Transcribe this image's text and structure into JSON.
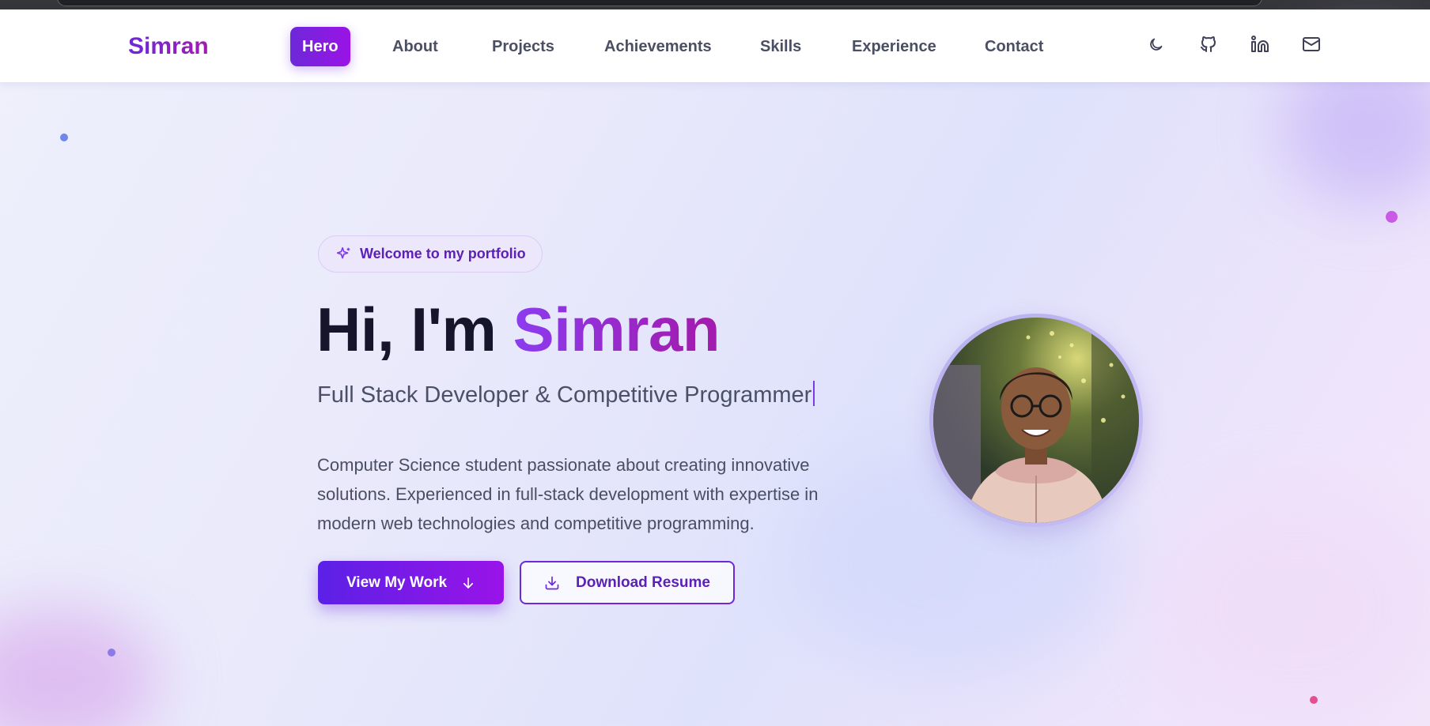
{
  "brand": {
    "name": "Simran"
  },
  "nav": {
    "items": [
      {
        "label": "Hero",
        "active": true
      },
      {
        "label": "About",
        "active": false
      },
      {
        "label": "Projects",
        "active": false
      },
      {
        "label": "Achievements",
        "active": false
      },
      {
        "label": "Skills",
        "active": false
      },
      {
        "label": "Experience",
        "active": false
      },
      {
        "label": "Contact",
        "active": false
      }
    ],
    "icons": [
      "moon-icon",
      "github-icon",
      "linkedin-icon",
      "mail-icon"
    ]
  },
  "hero": {
    "badge": "Welcome to my portfolio",
    "greeting": "Hi, I'm",
    "name": "Simran",
    "subtitle": "Full Stack Developer & Competitive Programmer",
    "description": "Computer Science student passionate about creating innovative solutions. Experienced in full-stack development with expertise in modern web technologies and competitive programming.",
    "primary_button": "View My Work",
    "secondary_button": "Download Resume"
  },
  "colors": {
    "accent": "#7c3aed",
    "accent_gradient_end": "#a21caf",
    "text_dark": "#15152b"
  }
}
